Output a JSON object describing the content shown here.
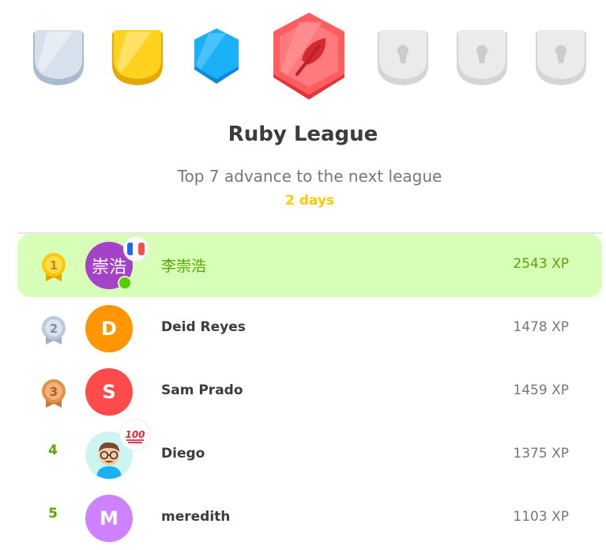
{
  "league": {
    "title": "Ruby League",
    "subtitle": "Top 7 advance to the next league",
    "time_left": "2 days"
  },
  "badges": [
    {
      "name": "silver",
      "color": "#c9d6e3",
      "state": "unlocked"
    },
    {
      "name": "gold",
      "color": "#ffd900",
      "state": "unlocked"
    },
    {
      "name": "sapphire",
      "color": "#1cb0f6",
      "state": "unlocked"
    },
    {
      "name": "ruby",
      "color": "#ff4b4b",
      "state": "current"
    },
    {
      "name": "locked-5",
      "color": "#e5e5e5",
      "state": "locked"
    },
    {
      "name": "locked-6",
      "color": "#e5e5e5",
      "state": "locked"
    },
    {
      "name": "locked-7",
      "color": "#e5e5e5",
      "state": "locked"
    }
  ],
  "leaderboard": [
    {
      "rank": "1",
      "avatar_text": "崇浩",
      "avatar_color": "#a443c9",
      "name": "李崇浩",
      "xp": "2543 XP",
      "is_me": true,
      "flag": "france",
      "online": true
    },
    {
      "rank": "2",
      "avatar_text": "D",
      "avatar_color": "#ff9600",
      "name": "Deid Reyes",
      "xp": "1478 XP"
    },
    {
      "rank": "3",
      "avatar_text": "S",
      "avatar_color": "#ff4b4b",
      "name": "Sam Prado",
      "xp": "1459 XP"
    },
    {
      "rank": "4",
      "avatar_text": "",
      "avatar_color": "#ccf5f1",
      "name": "Diego",
      "xp": "1375 XP",
      "sticker": "100"
    },
    {
      "rank": "5",
      "avatar_text": "M",
      "avatar_color": "#ce82ff",
      "name": "meredith",
      "xp": "1103 XP"
    }
  ]
}
